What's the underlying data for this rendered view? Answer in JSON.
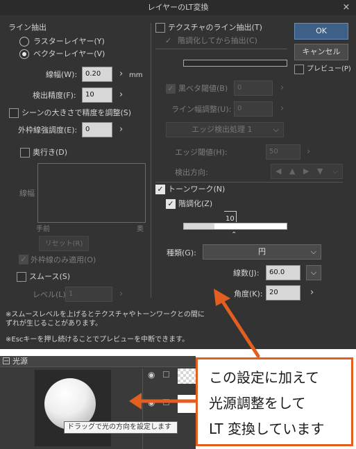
{
  "dialog": {
    "title": "レイヤーのLT変換",
    "close_symbol": "×",
    "ok_label": "OK",
    "cancel_label": "キャンセル",
    "preview_label": "プレビュー(P)"
  },
  "line_extract": {
    "header": "ライン抽出",
    "raster_label": "ラスターレイヤー(Y)",
    "vector_label": "ベクターレイヤー(V)",
    "line_width_label": "線幅(W):",
    "line_width_value": "0.20",
    "line_width_unit": "mm",
    "precision_label": "検出精度(F):",
    "precision_value": "10",
    "scene_adjust_label": "シーンの大きさで精度を調整(S)",
    "outline_label": "外枠線強調度(E):",
    "outline_value": "0",
    "depth_label": "奥行き(D)",
    "graph_ylabel": "線幅",
    "graph_left": "手前",
    "graph_right": "奥",
    "reset_label": "リセット(R)",
    "outer_only_label": "外枠線のみ適用(O)",
    "smooth_label": "スムース(S)",
    "level_label": "レベル(L):",
    "level_value": "1"
  },
  "texture": {
    "texture_label": "テクスチャのライン抽出(T)",
    "posterize_label": "階調化してから抽出(C)",
    "black_threshold_label": "黒ベタ閾値(B)",
    "black_threshold_value": "0",
    "line_width_adjust_label": "ライン幅調整(U):",
    "line_width_adjust_value": "0",
    "edge_method": "エッジ検出処理 1",
    "edge_threshold_label": "エッジ閾値(H):",
    "edge_threshold_value": "50",
    "direction_label": "検出方向:"
  },
  "tonework": {
    "tonework_label": "トーンワーク(N)",
    "posterize_label": "階調化(Z)",
    "slider_value": "10",
    "slider_fraction": 0.3,
    "type_label": "種類(G):",
    "type_value": "円",
    "lines_label": "線数(J):",
    "lines_value": "60.0",
    "angle_label": "角度(K):",
    "angle_value": "20"
  },
  "notes": {
    "note1_line1": "※スムースレベルを上げるとテクスチャやトーンワークとの間に",
    "note1_line2": "ずれが生じることがあります。",
    "note2": "※Escキーを押し続けることでプレビューを中断できます。"
  },
  "light_panel": {
    "header": "光源",
    "collapse_symbol": "−",
    "tooltip": "ドラッグで光の方向を設定します"
  },
  "annotation": {
    "line1": "この設定に加えて",
    "line2": "光源調整をして",
    "line3": "LT 変換しています",
    "color": "#e35f20"
  }
}
